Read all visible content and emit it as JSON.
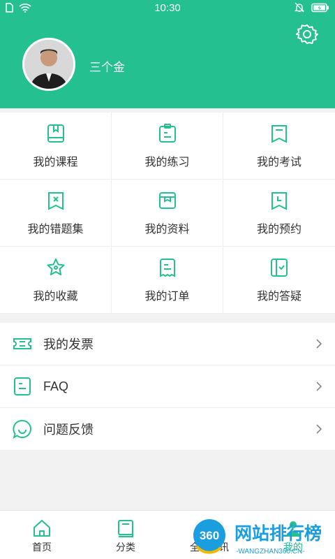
{
  "status": {
    "time": "10:30"
  },
  "profile": {
    "name": "三个金"
  },
  "grid": [
    {
      "label": "我的课程",
      "icon": "book-icon"
    },
    {
      "label": "我的练习",
      "icon": "clipboard-icon"
    },
    {
      "label": "我的考试",
      "icon": "exam-icon"
    },
    {
      "label": "我的错题集",
      "icon": "wrong-questions-icon"
    },
    {
      "label": "我的资料",
      "icon": "materials-icon"
    },
    {
      "label": "我的预约",
      "icon": "appointment-icon"
    },
    {
      "label": "我的收藏",
      "icon": "star-icon"
    },
    {
      "label": "我的订单",
      "icon": "order-icon"
    },
    {
      "label": "我的答疑",
      "icon": "qa-icon"
    }
  ],
  "list": [
    {
      "label": "我的发票",
      "icon": "ticket-icon"
    },
    {
      "label": "FAQ",
      "icon": "document-icon"
    },
    {
      "label": "问题反馈",
      "icon": "feedback-icon"
    }
  ],
  "tabs": [
    {
      "label": "首页",
      "icon": "home-icon"
    },
    {
      "label": "分类",
      "icon": "category-icon"
    },
    {
      "label": "全部资讯",
      "icon": "news-icon"
    },
    {
      "label": "我的",
      "icon": "person-icon"
    }
  ],
  "watermark": {
    "logo": "360",
    "text": "网站排行榜",
    "sub": "-WANGZHAN360.CN-"
  },
  "colors": {
    "accent": "#24c08f",
    "background": "#f2f2f2"
  }
}
